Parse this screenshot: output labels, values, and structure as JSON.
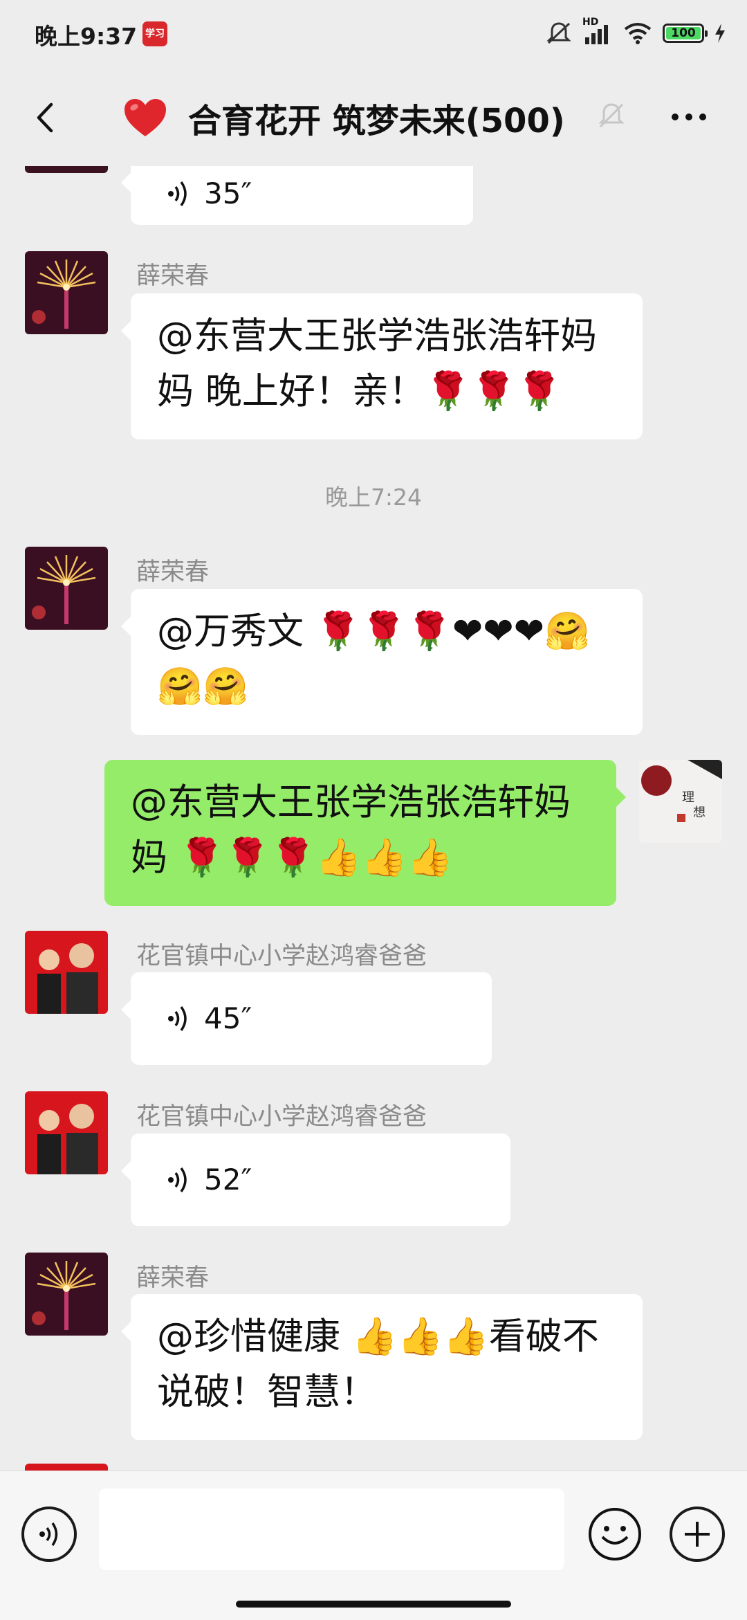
{
  "status_bar": {
    "time": "晚上9:37",
    "app_badge": "学习",
    "net_label": "HD",
    "battery": "100"
  },
  "header": {
    "title": "合育花开 筑梦未来(500)",
    "back_icon": "chevron-left-icon",
    "title_icon": "red-heart-icon",
    "mute_icon": "muted-bell-icon",
    "more_icon": "more-dots-icon"
  },
  "messages": [
    {
      "type": "voice",
      "duration": "35″"
    },
    {
      "type": "text",
      "sender": "薛荣春",
      "text": "@东营大王张学浩张浩轩妈妈  晚上好！亲！🌹🌹🌹"
    },
    {
      "type": "time",
      "text": "晚上7:24"
    },
    {
      "type": "text",
      "sender": "薛荣春",
      "text": "@万秀文 🌹🌹🌹❤❤❤🤗🤗🤗"
    },
    {
      "type": "text",
      "mine": true,
      "text": "@东营大王张学浩张浩轩妈妈 🌹🌹🌹👍👍👍"
    },
    {
      "type": "voice",
      "sender": "花官镇中心小学赵鸿睿爸爸",
      "duration": "45″"
    },
    {
      "type": "voice",
      "sender": "花官镇中心小学赵鸿睿爸爸",
      "duration": "52″"
    },
    {
      "type": "text",
      "sender": "薛荣春",
      "text": "@珍惜健康 👍👍👍看破不说破！智慧！"
    }
  ],
  "input_bar": {
    "voice_icon": "voice-input-icon",
    "emoji_icon": "emoji-icon",
    "plus_icon": "plus-icon"
  },
  "colors": {
    "background": "#ededed",
    "my_bubble": "#95ec69",
    "other_bubble": "#ffffff",
    "battery": "#4cd964"
  }
}
